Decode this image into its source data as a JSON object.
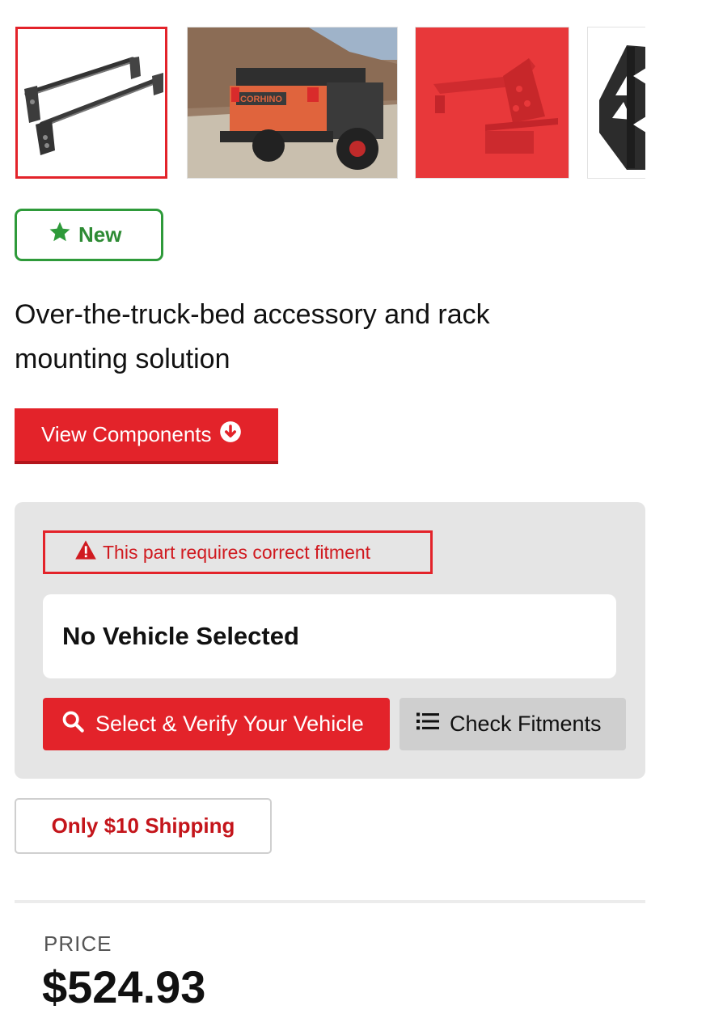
{
  "gallery": {
    "thumbnails": [
      {
        "name": "crossbar-rack-thumbnail",
        "selected": true
      },
      {
        "name": "truck-photo-thumbnail",
        "selected": false,
        "photo_text": "CORHINO"
      },
      {
        "name": "red-bracket-thumbnail",
        "selected": false
      },
      {
        "name": "side-plate-thumbnail",
        "selected": false
      }
    ]
  },
  "badge": {
    "label": "New",
    "icon": "star-icon",
    "color": "#2e9a3a"
  },
  "product": {
    "description": "Over-the-truck-bed accessory and rack mounting solution"
  },
  "view_components": {
    "label": "View Components",
    "icon": "arrow-circle-down-icon"
  },
  "fitment": {
    "warning": "This part requires correct fitment",
    "warning_icon": "warning-triangle-icon",
    "vehicle_status": "No Vehicle Selected",
    "select_button": "Select & Verify Your Vehicle",
    "select_icon": "search-icon",
    "check_button": "Check Fitments",
    "check_icon": "list-icon"
  },
  "shipping": {
    "label": "Only $10 Shipping"
  },
  "pricing": {
    "label": "PRICE",
    "value": "$524.93"
  },
  "colors": {
    "accent": "#e3232a",
    "success": "#2e9a3a",
    "panel": "#e5e5e5"
  }
}
